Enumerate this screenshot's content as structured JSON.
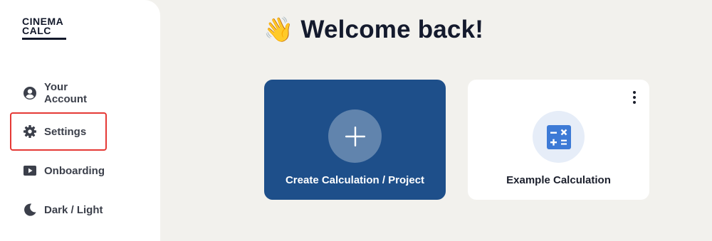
{
  "brand": {
    "line1": "CINEMA",
    "line2": "CALC"
  },
  "sidebar": {
    "items": [
      {
        "label": "Your Account",
        "icon": "account-circle-icon"
      },
      {
        "label": "Settings",
        "icon": "gear-icon"
      },
      {
        "label": "Onboarding",
        "icon": "play-icon"
      },
      {
        "label": "Dark / Light",
        "icon": "moon-icon"
      }
    ]
  },
  "main": {
    "welcome_emoji": "👋",
    "welcome_title": "Welcome back!",
    "cards": [
      {
        "label": "Create Calculation / Project",
        "icon": "plus-icon"
      },
      {
        "label": "Example Calculation",
        "icon": "calculator-icon"
      }
    ]
  },
  "colors": {
    "background": "#f2f1ed",
    "sidebar": "#ffffff",
    "primary_card": "#1e4f8a",
    "highlight_border": "#e53935",
    "calculator_icon": "#3d7ad6"
  }
}
